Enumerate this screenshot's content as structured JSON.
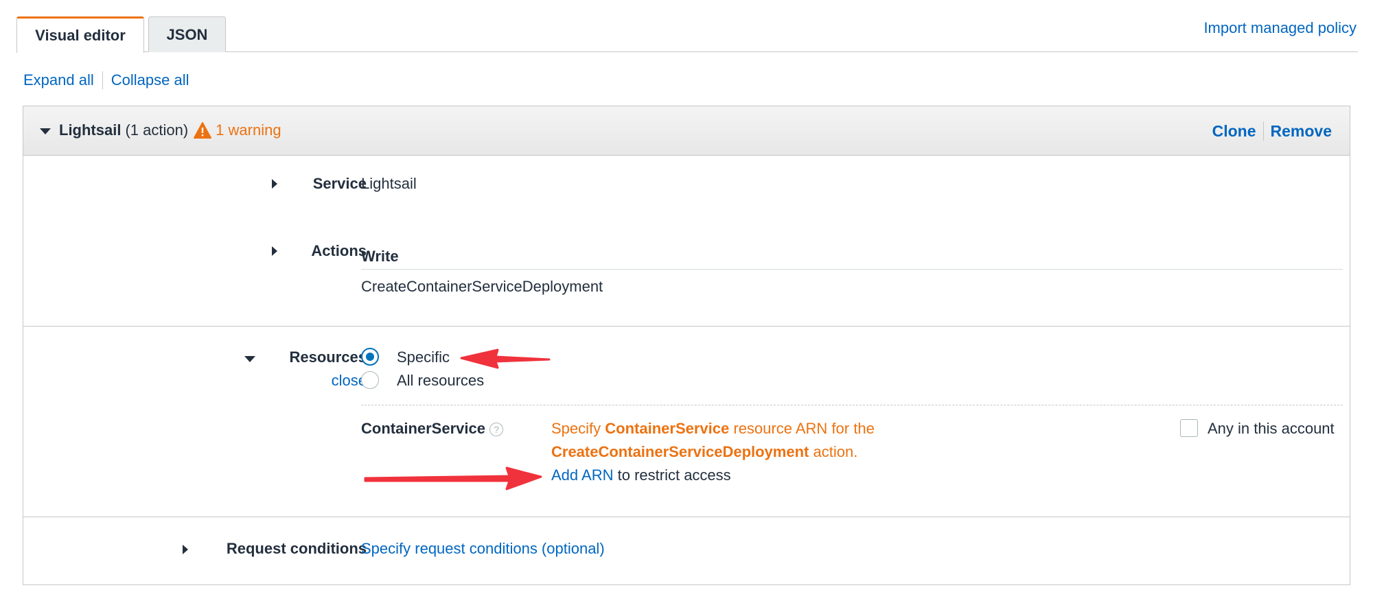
{
  "tabs": [
    {
      "label": "Visual editor",
      "active": true
    },
    {
      "label": "JSON",
      "active": false
    }
  ],
  "import_link": "Import managed policy",
  "expand_all": "Expand all",
  "collapse_all": "Collapse all",
  "statement": {
    "service_name": "Lightsail",
    "action_count": "(1 action)",
    "warning_text": "1 warning",
    "clone": "Clone",
    "remove": "Remove"
  },
  "service": {
    "label": "Service",
    "value": "Lightsail"
  },
  "actions": {
    "label": "Actions",
    "group": "Write",
    "item": "CreateContainerServiceDeployment"
  },
  "resources": {
    "label": "Resources",
    "close": "close",
    "options": [
      {
        "label": "Specific",
        "checked": true
      },
      {
        "label": "All resources",
        "checked": false
      }
    ],
    "container_service": {
      "label": "ContainerService",
      "help": "?",
      "msg_prefix": "Specify",
      "msg_resource": "ContainerService",
      "msg_mid": "resource ARN for the",
      "msg_action": "CreateContainerServiceDeployment",
      "msg_suffix": "action.",
      "add_arn": "Add ARN",
      "add_arn_suffix": "to restrict access",
      "any_account": "Any in this account"
    }
  },
  "request_conditions": {
    "label": "Request conditions",
    "link": "Specify request conditions (optional)"
  },
  "colors": {
    "link": "#0066c0",
    "warning": "#ec7211",
    "annotation_arrow": "#f0323c",
    "radio_selected": "#0073bb"
  }
}
